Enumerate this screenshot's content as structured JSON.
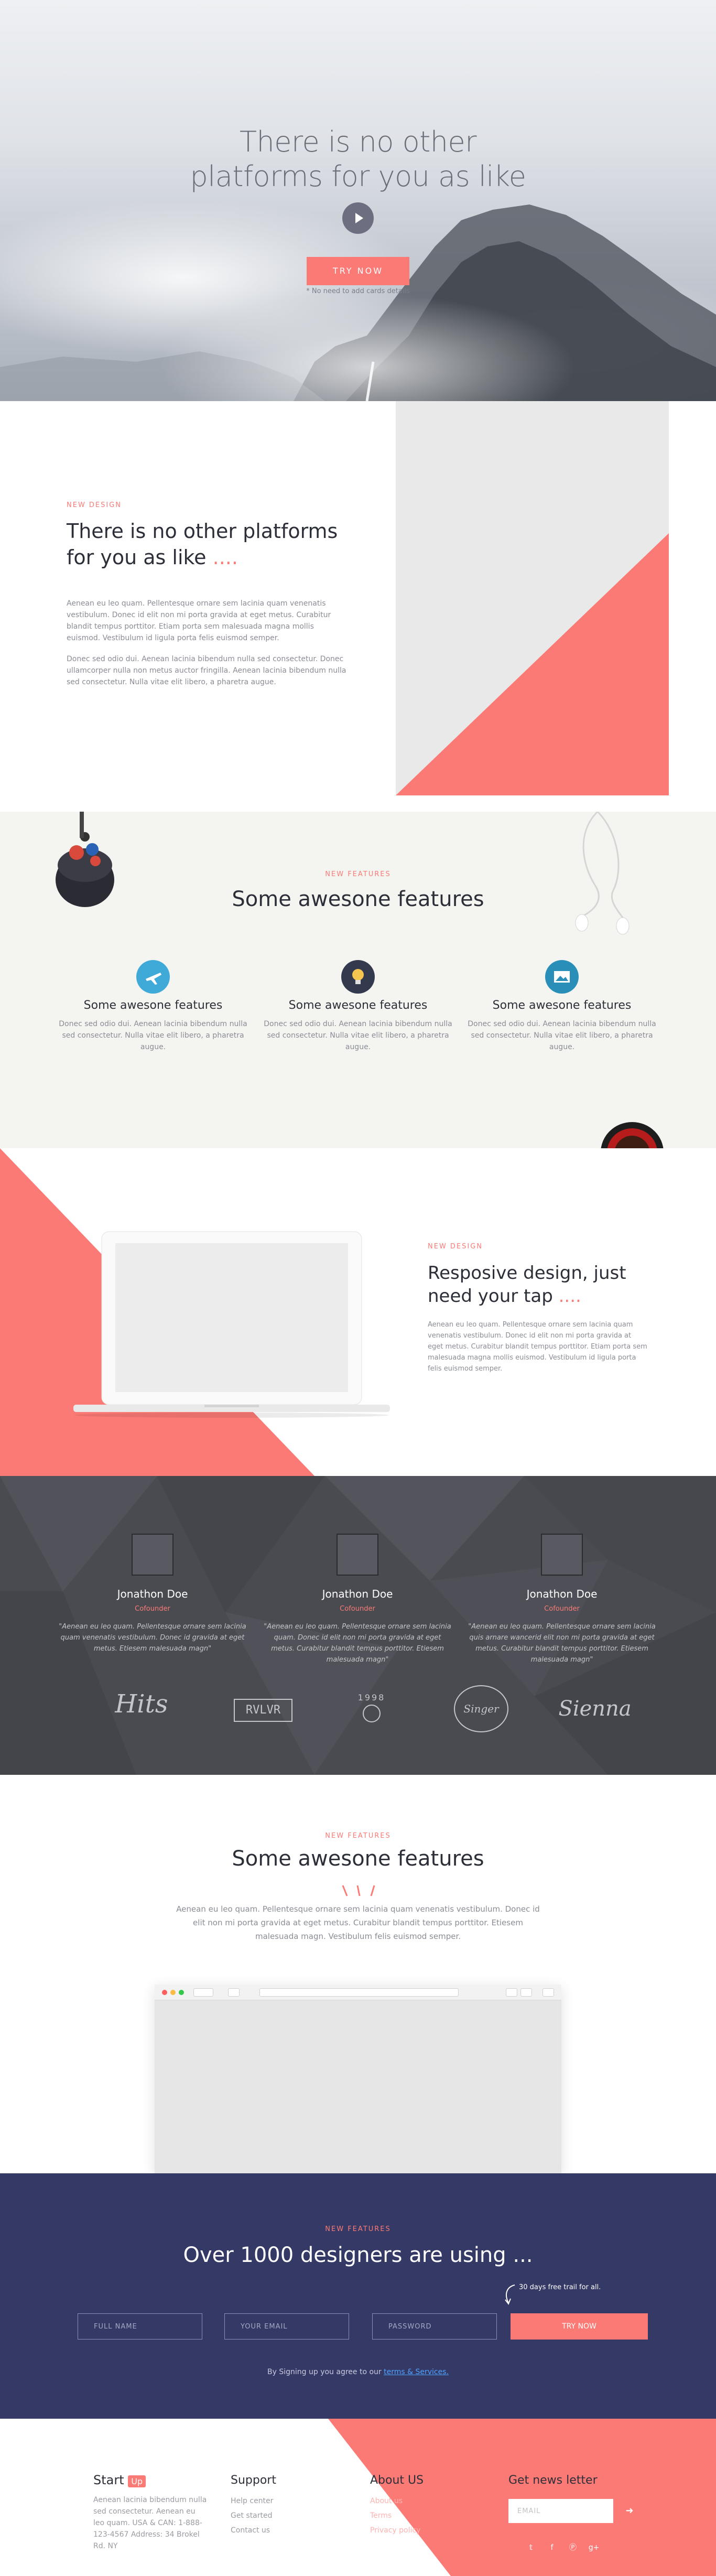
{
  "hero": {
    "title_line1": "There is no other",
    "title_line2": "platforms for you as like",
    "cta": "TRY NOW",
    "note": "* No need to add cards details"
  },
  "intro": {
    "eyebrow": "NEW DESIGN",
    "title": "There is no other platforms for you as like",
    "title_dots": "....",
    "para1": "Aenean eu leo quam. Pellentesque ornare sem lacinia quam venenatis vestibulum. Donec id elit non mi porta gravida at eget metus. Curabitur blandit tempus porttitor. Etiam porta sem malesuada magna mollis euismod. Vestibulum id ligula porta felis euismod semper.",
    "para2": "Donec sed odio dui. Aenean lacinia bibendum nulla sed consectetur. Donec ullamcorper nulla non metus auctor fringilla. Aenean lacinia bibendum nulla sed consectetur. Nulla vitae elit libero, a pharetra augue."
  },
  "features": {
    "eyebrow": "NEW FEATURES",
    "title": "Some awesone features",
    "items": [
      {
        "title": "Some awesone features",
        "text": "Donec sed odio dui. Aenean lacinia bibendum nulla sed consectetur. Nulla vitae elit libero, a pharetra augue.",
        "icon": "airplane-icon",
        "color": "#3fa9d8"
      },
      {
        "title": "Some awesone features",
        "text": "Donec sed odio dui. Aenean lacinia bibendum nulla sed consectetur. Nulla vitae elit libero, a pharetra augue.",
        "icon": "lightbulb-icon",
        "color": "#343a4e"
      },
      {
        "title": "Some awesone features",
        "text": "Donec sed odio dui. Aenean lacinia bibendum nulla sed consectetur. Nulla vitae elit libero, a pharetra augue.",
        "icon": "picture-icon",
        "color": "#2a8fb8"
      }
    ]
  },
  "responsive": {
    "eyebrow": "NEW DESIGN",
    "title": "Resposive design, just need your tap",
    "title_dots": "....",
    "text": "Aenean eu leo quam. Pellentesque ornare sem lacinia quam venenatis vestibulum. Donec id elit non mi porta gravida at eget metus. Curabitur blandit tempus porttitor. Etiam porta sem malesuada magna mollis euismod. Vestibulum id ligula porta felis euismod semper."
  },
  "testimonials": {
    "items": [
      {
        "name": "Jonathon Doe",
        "role": "Cofounder",
        "quote": "\"Aenean eu leo quam. Pellentesque ornare sem lacinia quam venenatis vestibulum. Donec id gravida at eget metus. Etiesem malesuada magn\""
      },
      {
        "name": "Jonathon Doe",
        "role": "Cofounder",
        "quote": "\"Aenean eu leo quam. Pellentesque ornare sem lacinia quam. Donec id elit non mi porta gravida at eget metus. Curabitur blandit tempus porttitor. Etiesem malesuada magn\""
      },
      {
        "name": "Jonathon Doe",
        "role": "Cofounder",
        "quote": "\"Aenean eu leo quam. Pellentesque ornare sem lacinia quis arnare wancerid elit non mi porta gravida at eget metus. Curabitur blandit tempus porttitor. Etiesem malesuada magn\""
      }
    ],
    "brands": [
      "Hits",
      "RVLVR",
      "1998",
      "Singer",
      "Sienna"
    ]
  },
  "showcase": {
    "eyebrow": "NEW FEATURES",
    "title": "Some awesone features",
    "text": "Aenean eu leo quam. Pellentesque ornare sem lacinia quam venenatis vestibulum. Donec id elit non mi porta gravida at eget metus. Curabitur blandit tempus porttitor. Etiesem malesuada magn. Vestibulum felis euismod semper."
  },
  "signup": {
    "eyebrow": "NEW FEATURES",
    "title": "Over 1000 designers are using ...",
    "trial_note": "30 days free trail for all.",
    "name_placeholder": "FULL NAME",
    "email_placeholder": "YOUR EMAIL",
    "password_placeholder": "PASSWORD",
    "cta": "TRY NOW",
    "terms_prefix": "By Signing up you agree to our",
    "terms_link": "terms & Services."
  },
  "footer": {
    "logo_text": "Start",
    "logo_badge": "Up",
    "about": "Aenean lacinia bibendum nulla sed consectetur. Aenean eu leo quam. USA & CAN: 1-888-123-4567 Address: 34 Brokel Rd. NY",
    "support": {
      "title": "Support",
      "links": [
        "Help center",
        "Get started",
        "Contact us"
      ]
    },
    "aboutus": {
      "title": "About US",
      "links": [
        "About us",
        "Terms",
        "Privacy policy"
      ]
    },
    "newsletter": {
      "title": "Get news letter",
      "email_placeholder": "EMAIL"
    },
    "accent": "#fb7a76",
    "navy": "#353966"
  }
}
